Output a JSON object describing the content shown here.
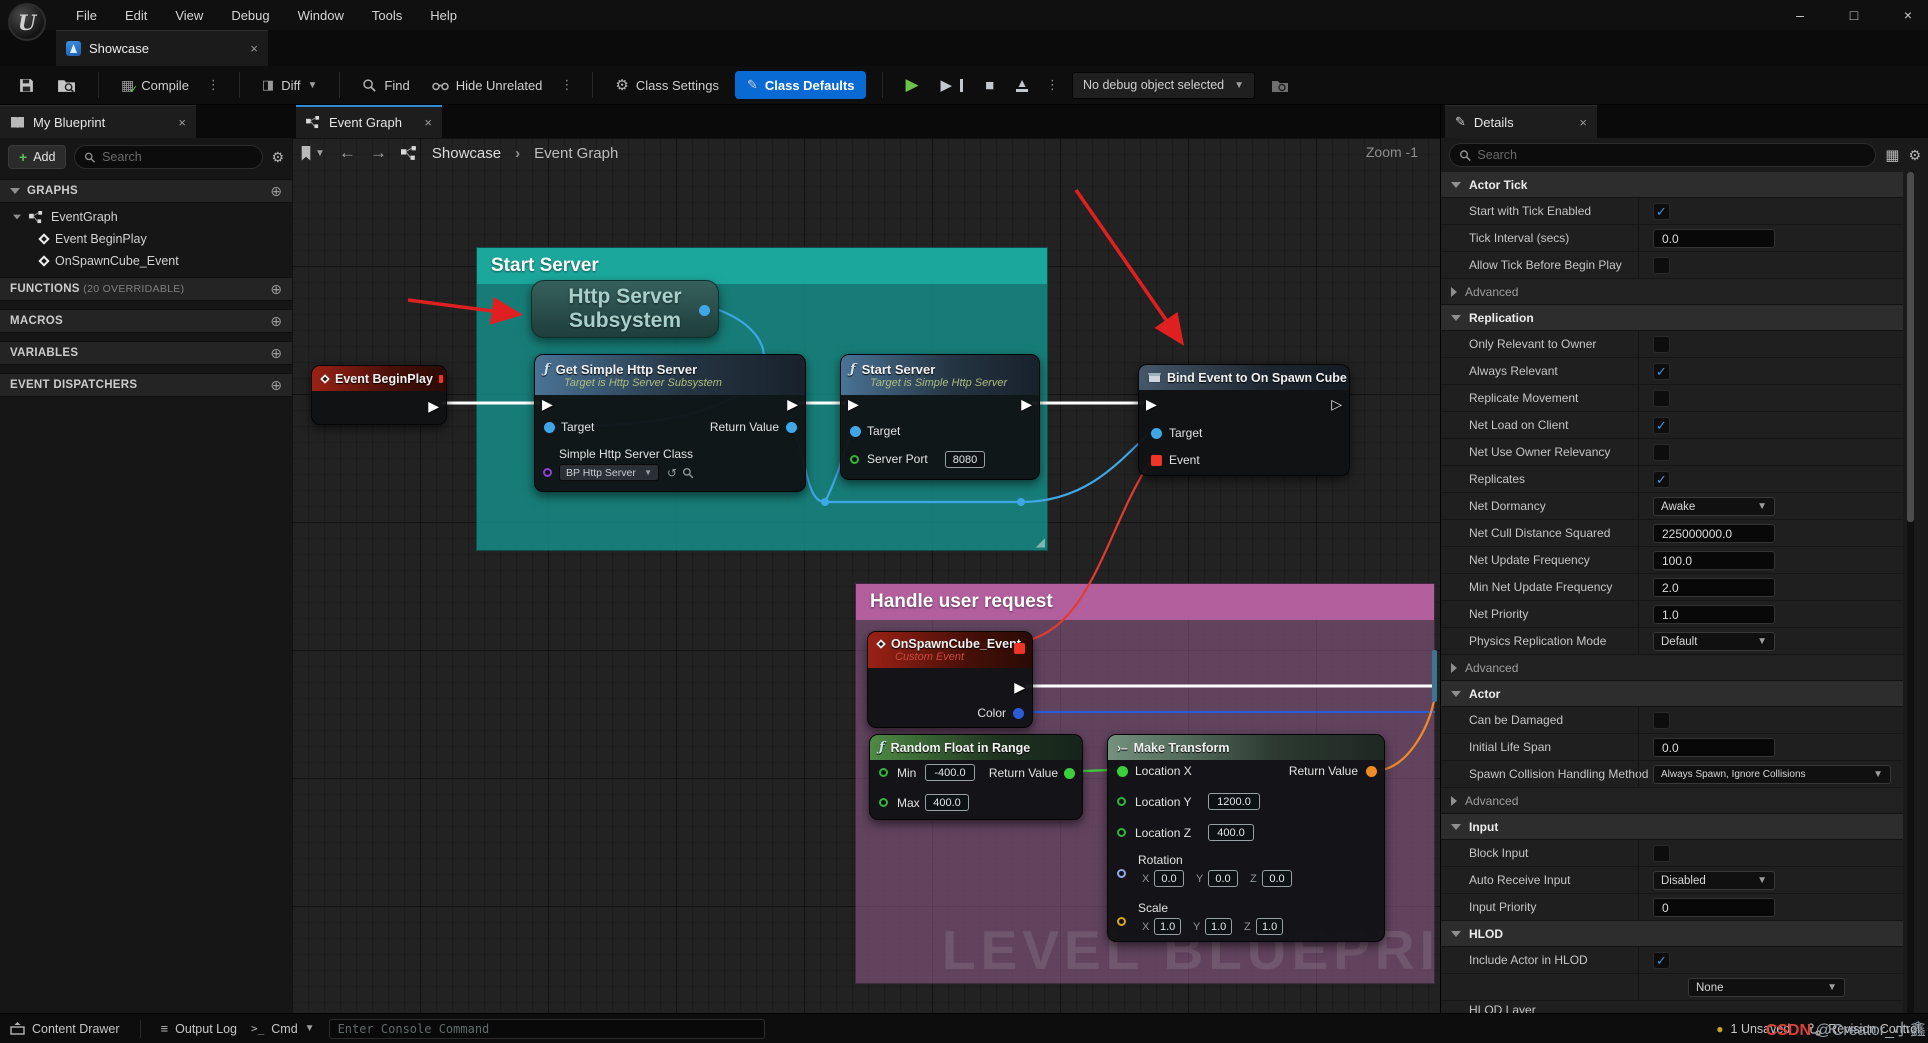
{
  "window": {
    "tab": "Showcase",
    "minimize_icon": "–",
    "maximize_icon": "□",
    "close_icon": "×"
  },
  "menu": {
    "items": [
      "File",
      "Edit",
      "View",
      "Debug",
      "Window",
      "Tools",
      "Help"
    ]
  },
  "toolbar": {
    "compile": "Compile",
    "diff": "Diff",
    "find": "Find",
    "hide_unrelated": "Hide Unrelated",
    "class_settings": "Class Settings",
    "class_defaults": "Class Defaults",
    "no_debug": "No debug object selected"
  },
  "left": {
    "tab": "My Blueprint",
    "add": "Add",
    "search_placeholder": "Search",
    "graphs": "GRAPHS",
    "event_graph": "EventGraph",
    "begin_play": "Event BeginPlay",
    "on_spawn": "OnSpawnCube_Event",
    "functions": "FUNCTIONS",
    "functions_note": "(20 OVERRIDABLE)",
    "macros": "MACROS",
    "variables": "VARIABLES",
    "event_dispatchers": "EVENT DISPATCHERS"
  },
  "graph": {
    "tab": "Event Graph",
    "crumb_root": "Showcase",
    "crumb_sep": "›",
    "crumb_current": "Event Graph",
    "zoom": "Zoom -1",
    "watermark": "LEVEL BLUEPRINT",
    "comments": {
      "start": "Start Server",
      "handle": "Handle user request"
    },
    "nodes": {
      "begin_play": {
        "title": "Event BeginPlay"
      },
      "http": {
        "line1": "Http Server",
        "line2": "Subsystem"
      },
      "get_simple": {
        "title": "Get Simple Http Server",
        "subtitle": "Target is Http Server Subsystem",
        "target": "Target",
        "ret": "Return Value",
        "class_label": "Simple Http Server Class",
        "class_value": "BP Http Server S"
      },
      "start": {
        "title": "Start Server",
        "subtitle": "Target is Simple Http Server",
        "target": "Target",
        "port": "Server Port",
        "port_value": "8080"
      },
      "bind": {
        "title": "Bind Event to On Spawn Cube",
        "target": "Target",
        "event": "Event"
      },
      "on_spawn": {
        "title": "OnSpawnCube_Event",
        "subtitle": "Custom Event",
        "color": "Color"
      },
      "random": {
        "title": "Random Float in Range",
        "min": "Min",
        "min_value": "-400.0",
        "max": "Max",
        "max_value": "400.0",
        "ret": "Return Value"
      },
      "make": {
        "title": "Make Transform",
        "loc_x": "Location X",
        "ret": "Return Value",
        "loc_y": "Location Y",
        "loc_y_value": "1200.0",
        "loc_z": "Location Z",
        "loc_z_value": "400.0",
        "rotation": "Rotation",
        "scale": "Scale",
        "axis": [
          "X",
          "Y",
          "Z"
        ],
        "rotation_values": [
          "0.0",
          "0.0",
          "0.0"
        ],
        "scale_values": [
          "1.0",
          "1.0",
          "1.0"
        ]
      }
    }
  },
  "details": {
    "tab": "Details",
    "search_placeholder": "Search",
    "rows": [
      {
        "type": "section",
        "label": "Actor Tick"
      },
      {
        "type": "check",
        "label": "Start with Tick Enabled",
        "checked": true
      },
      {
        "type": "input",
        "label": "Tick Interval (secs)",
        "value": "0.0"
      },
      {
        "type": "check",
        "label": "Allow Tick Before Begin Play",
        "checked": false
      },
      {
        "type": "advanced",
        "label": "Advanced"
      },
      {
        "type": "section",
        "label": "Replication"
      },
      {
        "type": "check",
        "label": "Only Relevant to Owner",
        "checked": false
      },
      {
        "type": "check",
        "label": "Always Relevant",
        "checked": true
      },
      {
        "type": "check",
        "label": "Replicate Movement",
        "checked": false
      },
      {
        "type": "check",
        "label": "Net Load on Client",
        "checked": true
      },
      {
        "type": "check",
        "label": "Net Use Owner Relevancy",
        "checked": false
      },
      {
        "type": "check",
        "label": "Replicates",
        "checked": true
      },
      {
        "type": "select",
        "label": "Net Dormancy",
        "value": "Awake"
      },
      {
        "type": "input",
        "label": "Net Cull Distance Squared",
        "value": "225000000.0"
      },
      {
        "type": "input",
        "label": "Net Update Frequency",
        "value": "100.0"
      },
      {
        "type": "input",
        "label": "Min Net Update Frequency",
        "value": "2.0"
      },
      {
        "type": "input",
        "label": "Net Priority",
        "value": "1.0"
      },
      {
        "type": "select",
        "label": "Physics Replication Mode",
        "value": "Default"
      },
      {
        "type": "advanced",
        "label": "Advanced"
      },
      {
        "type": "section",
        "label": "Actor"
      },
      {
        "type": "check",
        "label": "Can be Damaged",
        "checked": false
      },
      {
        "type": "input",
        "label": "Initial Life Span",
        "value": "0.0"
      },
      {
        "type": "select",
        "label": "Spawn Collision Handling Method",
        "value": "Always Spawn, Ignore Collisions",
        "wide": true
      },
      {
        "type": "advanced",
        "label": "Advanced"
      },
      {
        "type": "section",
        "label": "Input"
      },
      {
        "type": "check",
        "label": "Block Input",
        "checked": false
      },
      {
        "type": "select",
        "label": "Auto Receive Input",
        "value": "Disabled"
      },
      {
        "type": "input",
        "label": "Input Priority",
        "value": "0"
      },
      {
        "type": "section",
        "label": "HLOD"
      },
      {
        "type": "check",
        "label": "Include Actor in HLOD",
        "checked": true
      },
      {
        "type": "select",
        "label": "",
        "value": "None",
        "indent": true
      },
      {
        "type": "partial",
        "label": "HLOD Layer"
      }
    ]
  },
  "bottom": {
    "content_drawer": "Content Drawer",
    "output_log": "Output Log",
    "cmd": "Cmd",
    "console_placeholder": "Enter Console Command",
    "unsaved": "1 Unsaved",
    "revision": "Revision Control"
  },
  "watermark": {
    "brand": "CSDN",
    "user": "@Creator_小鑫"
  },
  "colors": {
    "accent_blue": "#0a6ad4",
    "exec_white": "#ffffff",
    "wire_blue": "#3fa7e8",
    "wire_green": "#3bd03b",
    "wire_orange": "#ef8b25",
    "wire_red": "#e03c30",
    "comment_teal": "#1ca79c",
    "comment_pink": "#b35f9e"
  }
}
